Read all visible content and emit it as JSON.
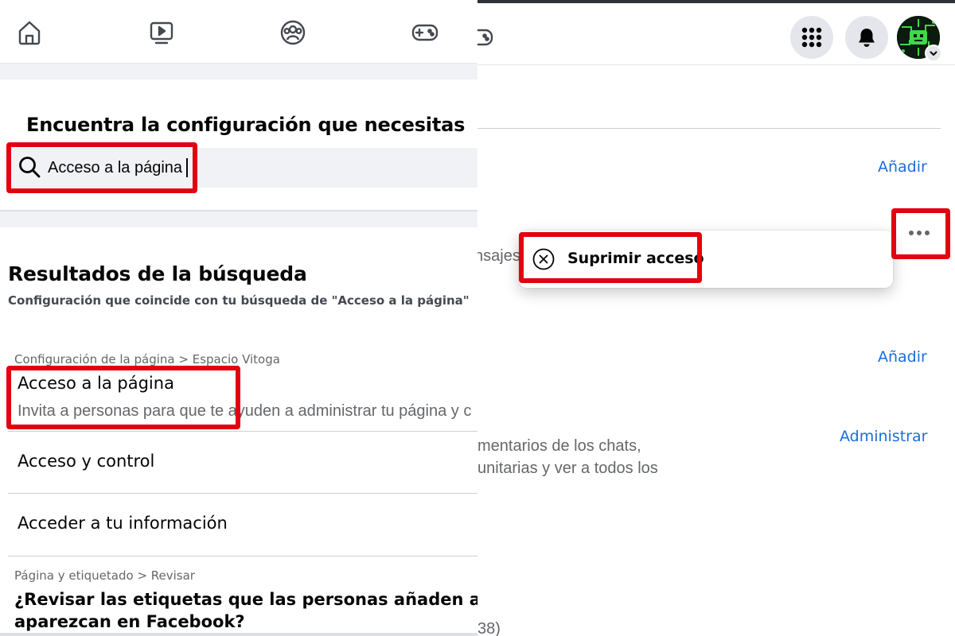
{
  "left": {
    "nav": {
      "icons": [
        "home-icon",
        "watch-icon",
        "groups-icon",
        "gaming-icon"
      ]
    },
    "settings_search": {
      "heading": "Encuentra la configuración que necesitas",
      "input_value": "Acceso a la página"
    },
    "results": {
      "title": "Resultados de la búsqueda",
      "subtitle": "Configuración que coincide con tu búsqueda de \"Acceso a la página\"",
      "items": [
        {
          "breadcrumb": "Configuración de la página > Espacio Vitoga",
          "title": "Acceso a la página",
          "description": "Invita a personas para que te ayuden a administrar tu página y c"
        },
        {
          "title": "Acceso y control"
        },
        {
          "title": "Acceder a tu información"
        },
        {
          "breadcrumb": "Página y etiquetado > Revisar",
          "title_line1": "¿Revisar las etiquetas que las personas añaden a tus pu",
          "title_line2": "aparezcan en Facebook?"
        }
      ]
    }
  },
  "right": {
    "header": {
      "icons": [
        "gaming-icon",
        "apps-grid-icon",
        "notifications-bell-icon",
        "profile-avatar"
      ]
    },
    "links": {
      "add_1": "Añadir",
      "add_2": "Añadir",
      "manage": "Administrar"
    },
    "fragments": {
      "messages": "nsajes",
      "chats_line1": "mentarios de los chats,",
      "chats_line2": "unitarias y ver a todos los",
      "bottom": "38)"
    },
    "context_menu": {
      "item_label": "Suprimir acceso",
      "item_icon": "remove-circle-x-icon"
    },
    "more_button_icon": "more-options-dots-icon"
  },
  "colors": {
    "highlight": "#e3000f",
    "link": "#1a6ed8",
    "gray_band": "#f0f2f5",
    "secondary_text": "#65676b"
  }
}
